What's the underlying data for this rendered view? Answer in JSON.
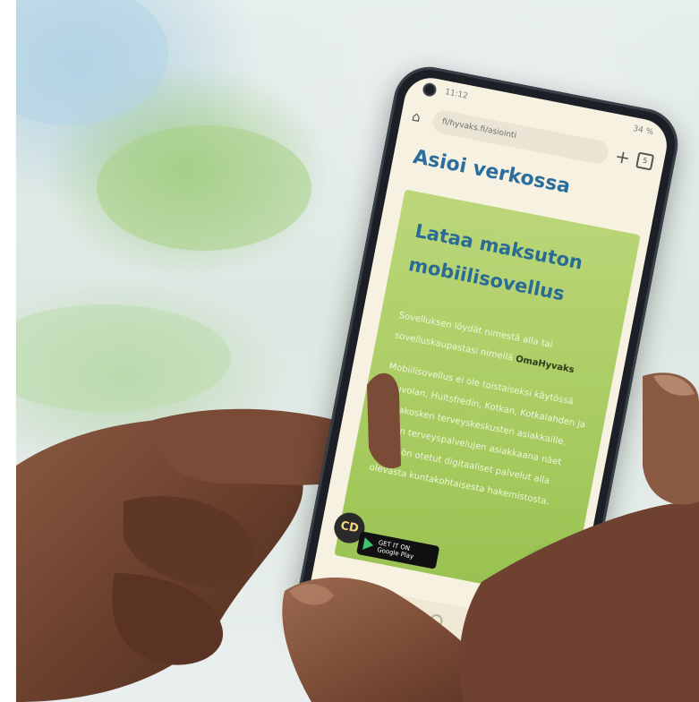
{
  "browser": {
    "status_time": "11:12",
    "status_right": "34 %",
    "url": "fi/hyvaks.fi/asiointi",
    "tab_count": "5"
  },
  "page": {
    "title": "Asioi verkossa"
  },
  "card": {
    "title": "Lataa maksuton mobiilisovellus",
    "para1": "Sovelluksen löydät nimestä alla tai sovelluskaupastasi nimellä",
    "app_name": "OmaHyvaks",
    "para2": "Mobiilisovellus ei ole toistaiseksi käytössä Kouvolan, Hultsfredin, Kotkan, Kotkalahden ja Tikkakosken terveyskeskusten asiakkaille. Niiden terveyspalvelujen asiakkaana näet käyttöön otetut digitaaliset palvelut alla olevasta kuntakohtaisesta hakemistosta."
  },
  "badge": {
    "small": "GET IT ON",
    "store": "Google Play"
  },
  "buttons": {
    "cc_label": "CD"
  },
  "colors": {
    "title_blue": "#2b6e9e",
    "card_green": "#a9cc62",
    "chat_blue": "#2a6fb5",
    "phone_frame": "#1c2026",
    "screen_bg": "#f6f1e1"
  }
}
